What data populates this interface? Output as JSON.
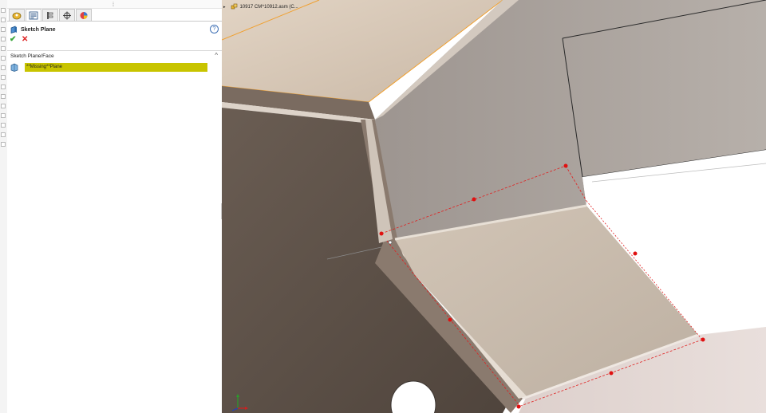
{
  "property_manager": {
    "title": "Sketch Plane",
    "help_label": "?",
    "ok_glyph": "✔",
    "cancel_glyph": "✕",
    "tabs": [
      "feature-manager",
      "property-manager",
      "configuration-manager",
      "dimxpert-manager",
      "display-manager"
    ],
    "group": {
      "title": "Sketch Plane/Face",
      "collapse_glyph": "^",
      "selection_value": "**Missing**Plane",
      "selection_color": "#c8c400"
    }
  },
  "breadcrumb": {
    "text": "10917 CM^10912.asm  (C..."
  },
  "panel_handle": "‹",
  "colors": {
    "ok": "#3aa63a",
    "cancel": "#dd2222",
    "sketch_point": "#dd1111",
    "model_dark": "#5e524a",
    "model_light": "#c9bdb0"
  }
}
